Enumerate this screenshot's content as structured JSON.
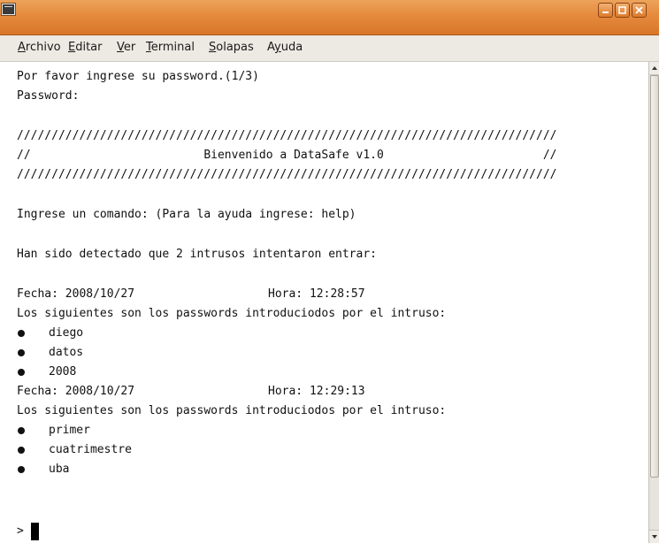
{
  "window": {
    "title": "",
    "controls": {
      "minimize_icon": "minimize-icon",
      "maximize_icon": "maximize-icon",
      "close_icon": "close-icon"
    },
    "titlebar_color": "#e58a3d"
  },
  "menubar": {
    "items": [
      {
        "mnemonic": "A",
        "rest": "rchivo"
      },
      {
        "mnemonic": "E",
        "rest": "ditar"
      },
      {
        "mnemonic": "V",
        "rest": "er"
      },
      {
        "mnemonic": "T",
        "rest": "erminal"
      },
      {
        "mnemonic": "S",
        "rest": "olapas"
      },
      {
        "pre": "A",
        "mnemonic": "y",
        "rest": "uda"
      }
    ]
  },
  "terminal": {
    "lines": [
      "Por favor ingrese su password.(1/3)",
      "Password:",
      "//////////////////////////////////////////////////////////////////////////////",
      "//                         Bienvenido a DataSafe v1.0                       //",
      "//////////////////////////////////////////////////////////////////////////////",
      "Ingrese un comando: (Para la ayuda ingrese: help)",
      "Han sido detectado que 2 intrusos intentaron entrar:"
    ],
    "intrusions": [
      {
        "fecha": "Fecha: 2008/10/27",
        "hora": "Hora: 12:28:57",
        "intro": "Los siguientes son los passwords introduciodos por el intruso:",
        "passwords": [
          "diego",
          "datos",
          "2008"
        ]
      },
      {
        "fecha": "Fecha: 2008/10/27",
        "hora": "Hora: 12:29:13",
        "intro": "Los siguientes son los passwords introduciodos por el intruso:",
        "passwords": [
          "primer",
          "cuatrimestre",
          "uba"
        ]
      }
    ],
    "prompt": ">"
  }
}
